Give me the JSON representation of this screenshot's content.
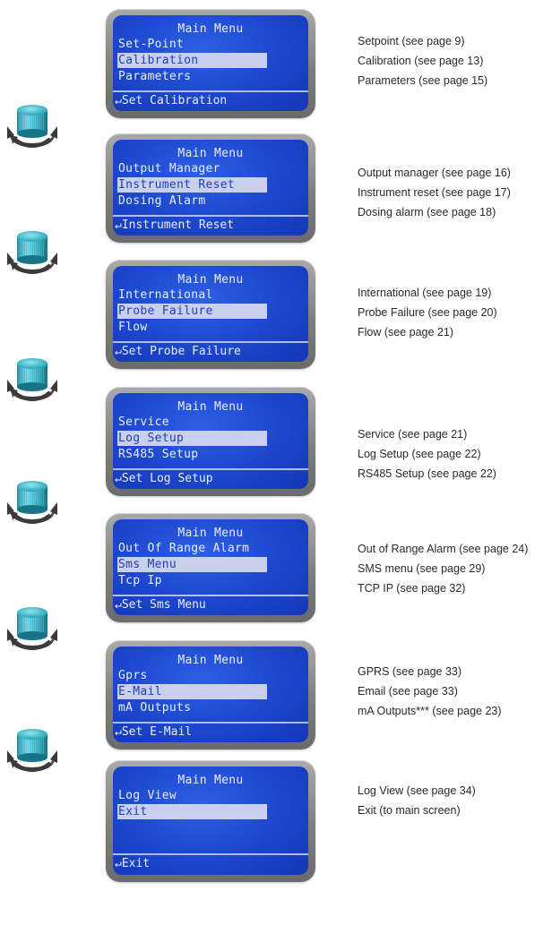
{
  "screens": [
    {
      "title": "Main Menu",
      "items": [
        "Set-Point",
        "Calibration",
        "Parameters"
      ],
      "selected": 1,
      "footer": "↵Set Calibration",
      "descriptions": [
        "Setpoint (see page 9)",
        "Calibration (see page 13)",
        "Parameters (see page 15)"
      ]
    },
    {
      "title": "Main Menu",
      "items": [
        "Output Manager",
        "Instrument Reset",
        "Dosing Alarm"
      ],
      "selected": 1,
      "footer": "↵Instrument Reset",
      "descriptions": [
        "Output manager (see page 16)",
        "Instrument reset (see page 17)",
        "Dosing alarm (see page 18)"
      ]
    },
    {
      "title": "Main Menu",
      "items": [
        "International",
        "Probe Failure",
        "Flow"
      ],
      "selected": 1,
      "footer": "↵Set Probe Failure",
      "descriptions": [
        "International (see page 19)",
        "Probe Failure (see page 20)",
        "Flow (see page 21)"
      ]
    },
    {
      "title": "Main Menu",
      "items": [
        "Service",
        "Log Setup",
        "RS485 Setup"
      ],
      "selected": 1,
      "footer": "↵Set Log Setup",
      "descriptions": [
        "Service (see page 21)",
        "Log Setup (see page 22)",
        "RS485 Setup (see page 22)"
      ]
    },
    {
      "title": "Main Menu",
      "items": [
        "Out Of Range Alarm",
        "Sms Menu",
        "Tcp Ip"
      ],
      "selected": 1,
      "footer": "↵Set Sms Menu",
      "descriptions": [
        "Out of Range Alarm (see page 24)",
        "SMS menu (see page  29)",
        "TCP IP (see page 32)"
      ]
    },
    {
      "title": "Main Menu",
      "items": [
        "Gprs",
        "E-Mail",
        "mA Outputs"
      ],
      "selected": 1,
      "footer": "↵Set E-Mail",
      "descriptions": [
        "GPRS (see page 33)",
        "Email (see page 33)",
        "mA Outputs*** (see page 23)"
      ]
    },
    {
      "title": "Main Menu",
      "items": [
        "Log View",
        "Exit"
      ],
      "selected": 1,
      "footer": "↵Exit",
      "descriptions": [
        "Log View (see page 34)",
        "Exit (to main screen)"
      ]
    }
  ],
  "knob_icon": "rotary-knob-icon",
  "colors": {
    "lcd": "#1d48cf",
    "lcd_text": "#e8eeff",
    "highlight": "#c9d0ee",
    "bezel": "#7d7e80",
    "knob": "#3fb6c9"
  }
}
